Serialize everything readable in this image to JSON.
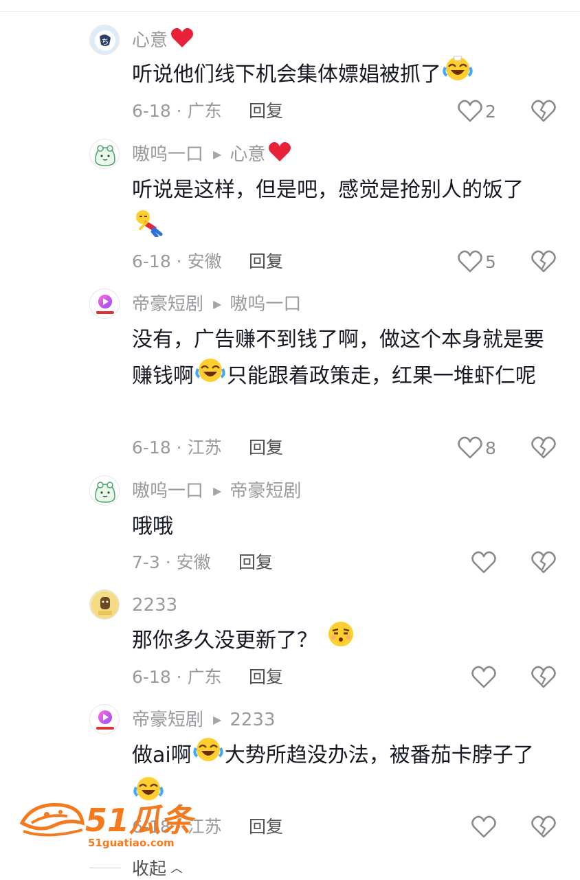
{
  "comments": [
    {
      "username": "心意",
      "reply_to": "",
      "text": "听说他们线下机会集体嫖娼被抓了",
      "date_location": "6-18 · 广东",
      "reply_label": "回复",
      "likes": "2"
    },
    {
      "username": "嗷呜一口",
      "reply_to": "心意",
      "text": "听说是这样，但是吧，感觉是抢别人的饭了",
      "date_location": "6-18 · 安徽",
      "reply_label": "回复",
      "likes": "5"
    },
    {
      "username": "帝豪短剧",
      "reply_to": "嗷呜一口",
      "text_a": "没有，广告赚不到钱了啊，做这个本身就是要赚钱啊",
      "text_b": "只能跟着政策走，红果一堆虾仁呢",
      "date_location": "6-18 · 江苏",
      "reply_label": "回复",
      "likes": "8"
    },
    {
      "username": "嗷呜一口",
      "reply_to": "帝豪短剧",
      "text": "哦哦",
      "date_location": "7-3 · 安徽",
      "reply_label": "回复",
      "likes": ""
    },
    {
      "username": "2233",
      "reply_to": "",
      "text": "那你多久没更新了？",
      "date_location": "6-18 · 广东",
      "reply_label": "回复",
      "likes": ""
    },
    {
      "username": "帝豪短剧",
      "reply_to": "2233",
      "text_a": "做ai啊",
      "text_b": "大势所趋没办法，被番茄卡脖子了",
      "date_location": "6-18 · 江苏",
      "reply_label": "回复",
      "likes": ""
    }
  ],
  "collapse_label": "收起",
  "watermark": {
    "brand": "51瓜条",
    "url": "51guatiao.com"
  },
  "colors": {
    "text_primary": "#161823",
    "text_secondary": "#9a9a9e",
    "watermark_orange": "#f47a1f"
  },
  "icons": [
    "heart-outline-icon",
    "broken-heart-icon",
    "red-heart-emoji",
    "crying-laughing-emoji",
    "lying-down-emoji",
    "smirk-emoji",
    "triangle-right-icon",
    "chevron-up-icon"
  ]
}
